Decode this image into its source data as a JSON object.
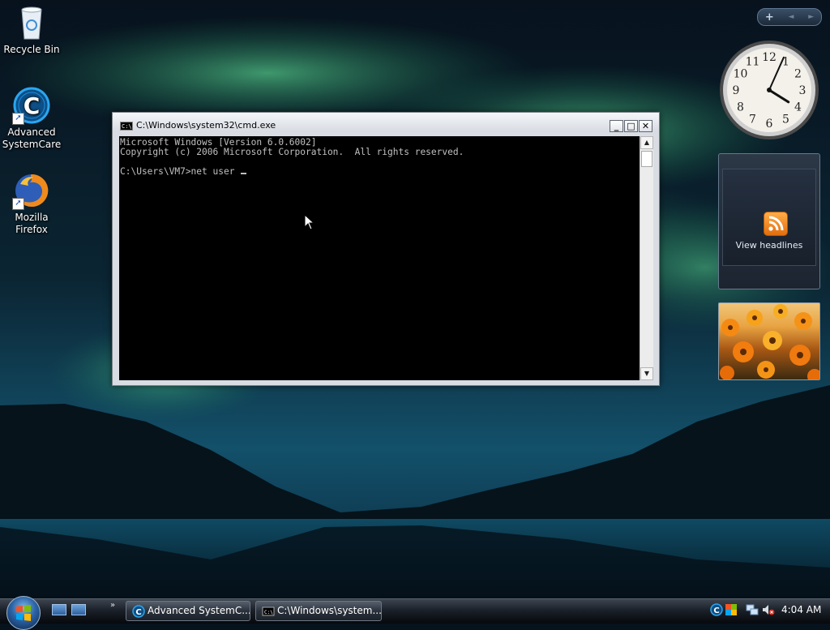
{
  "desktop": {
    "icons": [
      {
        "label": "Recycle Bin"
      },
      {
        "label": "Advanced SystemCare"
      },
      {
        "label": "Mozilla Firefox"
      }
    ]
  },
  "gadgets": {
    "toolbar": {
      "add_label": "+",
      "prev_label": "◄",
      "next_label": "►"
    },
    "clock": {
      "numerals": [
        "12",
        "1",
        "2",
        "3",
        "4",
        "5",
        "6",
        "7",
        "8",
        "9",
        "10",
        "11"
      ],
      "time": "4:04"
    },
    "feed": {
      "label": "View headlines"
    }
  },
  "cmd": {
    "title": "C:\\Windows\\system32\\cmd.exe",
    "icon_text": "C:\\",
    "lines": [
      "Microsoft Windows [Version 6.0.6002]",
      "Copyright (c) 2006 Microsoft Corporation.  All rights reserved.",
      "",
      "C:\\Users\\VM7>net user "
    ],
    "buttons": {
      "minimize": "_",
      "maximize": "□",
      "close": "✕"
    }
  },
  "taskbar": {
    "more_label": "»",
    "tasks": [
      {
        "label": "Advanced SystemC..."
      },
      {
        "label": "C:\\Windows\\system..."
      }
    ],
    "clock": "4:04 AM"
  },
  "colors": {
    "console_bg": "#000000",
    "console_fg": "#c0c0c0",
    "aurora": "#3fd88a"
  }
}
